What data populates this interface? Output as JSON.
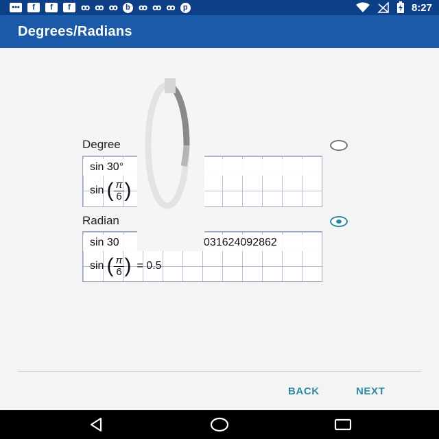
{
  "status_bar": {
    "time": "8:27",
    "left_icons": [
      "message-icon",
      "facebook-icon",
      "facebook-icon",
      "facebook-icon",
      "chain-icon",
      "chain-icon",
      "chain-icon",
      "bing-icon",
      "chain-icon",
      "chain-icon",
      "chain-icon",
      "pinterest-icon"
    ],
    "right_icons": [
      "wifi-icon",
      "no-signal-icon",
      "battery-charging-icon"
    ]
  },
  "app_bar": {
    "title": "Degrees/Radians"
  },
  "options": [
    {
      "label": "Degree",
      "selected": false,
      "line1": "sin 30°",
      "line2_prefix": "sin",
      "frac_num": "π",
      "frac_den": "6",
      "line2_suffix": ""
    },
    {
      "label": "Radian",
      "selected": true,
      "line1": "sin 30",
      "line1_tail": "031624092862",
      "line2_prefix": "sin",
      "frac_num": "π",
      "frac_den": "6",
      "line2_suffix": "= 0.5"
    }
  ],
  "actions": {
    "back": "BACK",
    "next": "NEXT"
  },
  "colors": {
    "status_bar": "#0d3f86",
    "app_bar": "#1b5aa8",
    "accent": "#2d8aa6",
    "background": "#f4f4f4"
  }
}
